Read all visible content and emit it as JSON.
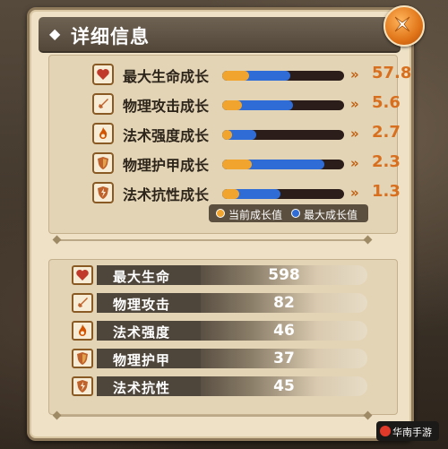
{
  "panel": {
    "title": "详细信息",
    "title_icon": "diamond-icon",
    "close_icon": "close-x-icon"
  },
  "growth": [
    {
      "icon": "heart-icon",
      "label": "最大生命成长",
      "value": "57.8",
      "current_fraction": 0.22,
      "max_fraction": 0.56
    },
    {
      "icon": "sword-icon",
      "label": "物理攻击成长",
      "value": "5.6",
      "current_fraction": 0.16,
      "max_fraction": 0.58
    },
    {
      "icon": "flame-icon",
      "label": "法术强度成长",
      "value": "2.7",
      "current_fraction": 0.08,
      "max_fraction": 0.28
    },
    {
      "icon": "shield-icon",
      "label": "物理护甲成长",
      "value": "2.3",
      "current_fraction": 0.24,
      "max_fraction": 0.84
    },
    {
      "icon": "magic-shield-icon",
      "label": "法术抗性成长",
      "value": "1.3",
      "current_fraction": 0.14,
      "max_fraction": 0.48
    }
  ],
  "legend": {
    "current_label": "当前成长值",
    "max_label": "最大成长值",
    "current_color": "#f2a52e",
    "max_color": "#2f6cd6"
  },
  "attributes": [
    {
      "icon": "heart-icon",
      "label": "最大生命",
      "value": "598"
    },
    {
      "icon": "sword-icon",
      "label": "物理攻击",
      "value": "82"
    },
    {
      "icon": "flame-icon",
      "label": "法术强度",
      "value": "46"
    },
    {
      "icon": "shield-icon",
      "label": "物理护甲",
      "value": "37"
    },
    {
      "icon": "magic-shield-icon",
      "label": "法术抗性",
      "value": "45"
    }
  ],
  "watermark": "华南手游"
}
